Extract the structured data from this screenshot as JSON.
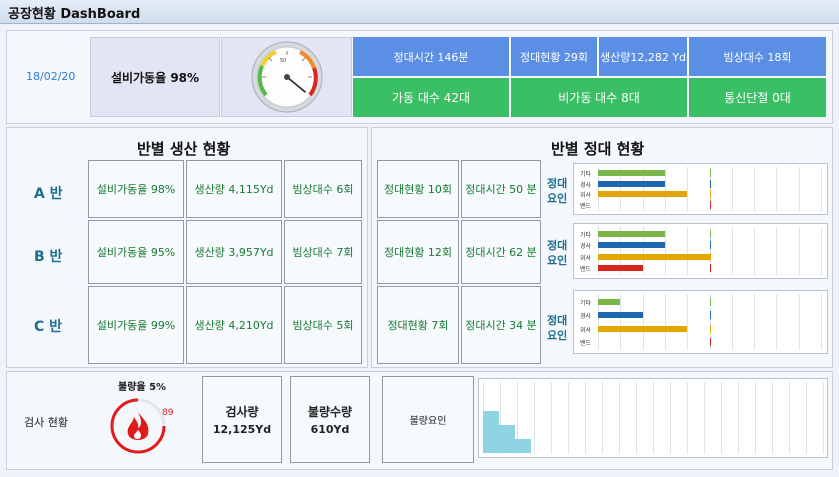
{
  "header": {
    "title": "공장현황 DashBoard"
  },
  "summary": {
    "date": "18/02/20",
    "utilization_label": "설비가동율 98%",
    "gauge_value": 0.98,
    "top_stats": [
      "정대시간 146분",
      "정대현황 29회",
      "생산량12,282 Yd",
      "빔상대수 18회"
    ],
    "status_stats": [
      "가동 대수 42대",
      "비가동 대수 8대",
      "통신단절 0대"
    ]
  },
  "production": {
    "title": "반별 생산 현황",
    "rows": [
      {
        "label": "A 반",
        "cells": [
          "설비가동율 98%",
          "생산량 4,115Yd",
          "빔상대수 6회"
        ]
      },
      {
        "label": "B 반",
        "cells": [
          "설비가동율 95%",
          "생산량 3,957Yd",
          "빔상대수 7회"
        ]
      },
      {
        "label": "C 반",
        "cells": [
          "설비가동율 99%",
          "생산량 4,210Yd",
          "빔상대수 5회"
        ]
      }
    ]
  },
  "stoppage": {
    "title": "반별 정대 현황",
    "factor_label_line1": "정대",
    "factor_label_line2": "요인",
    "rows": [
      {
        "cells": [
          "정대현황 10회",
          "정대시간 50 분"
        ]
      },
      {
        "cells": [
          "정대현황 12회",
          "정대시간 62 분"
        ]
      },
      {
        "cells": [
          "정대현황 7회",
          "정대시간 34 분"
        ]
      }
    ]
  },
  "chart_data": [
    {
      "type": "bar",
      "categories": [
        "기타",
        "경사",
        "위사",
        "밴드"
      ],
      "series": [
        {
          "values": [
            3,
            3,
            4,
            0
          ]
        }
      ],
      "colors": [
        "#7ab648",
        "#1f66b3",
        "#e3a600",
        "#d8261c"
      ]
    },
    {
      "type": "bar",
      "categories": [
        "기타",
        "경사",
        "위사",
        "밴드"
      ],
      "series": [
        {
          "values": [
            3,
            3,
            5,
            2
          ]
        }
      ],
      "colors": [
        "#7ab648",
        "#1f66b3",
        "#e3a600",
        "#d8261c"
      ]
    },
    {
      "type": "bar",
      "categories": [
        "기타",
        "경사",
        "위사",
        "밴드"
      ],
      "series": [
        {
          "values": [
            1,
            2,
            4,
            0
          ]
        }
      ],
      "colors": [
        "#7ab648",
        "#1f66b3",
        "#e3a600",
        "#d8261c"
      ]
    },
    {
      "type": "area",
      "title": "",
      "x": [
        0,
        1,
        2,
        3
      ],
      "values": [
        3,
        2,
        1,
        0
      ],
      "color": "#8fd4e2"
    }
  ],
  "inspection": {
    "label": "검사 현황",
    "defect_rate_label": "불량율 5%",
    "defect_gauge_value": "89",
    "defect_fraction": 0.05,
    "inspected_label": "검사량",
    "inspected_value": "12,125Yd",
    "defect_qty_label": "불량수량",
    "defect_qty_value": "610Yd",
    "defect_factor_label": "불량요인"
  },
  "colors": {
    "blue_cell": "#5b8fe6",
    "green_cell": "#3bbf65",
    "green_text": "#187a32",
    "flame": "#e01b1b"
  }
}
